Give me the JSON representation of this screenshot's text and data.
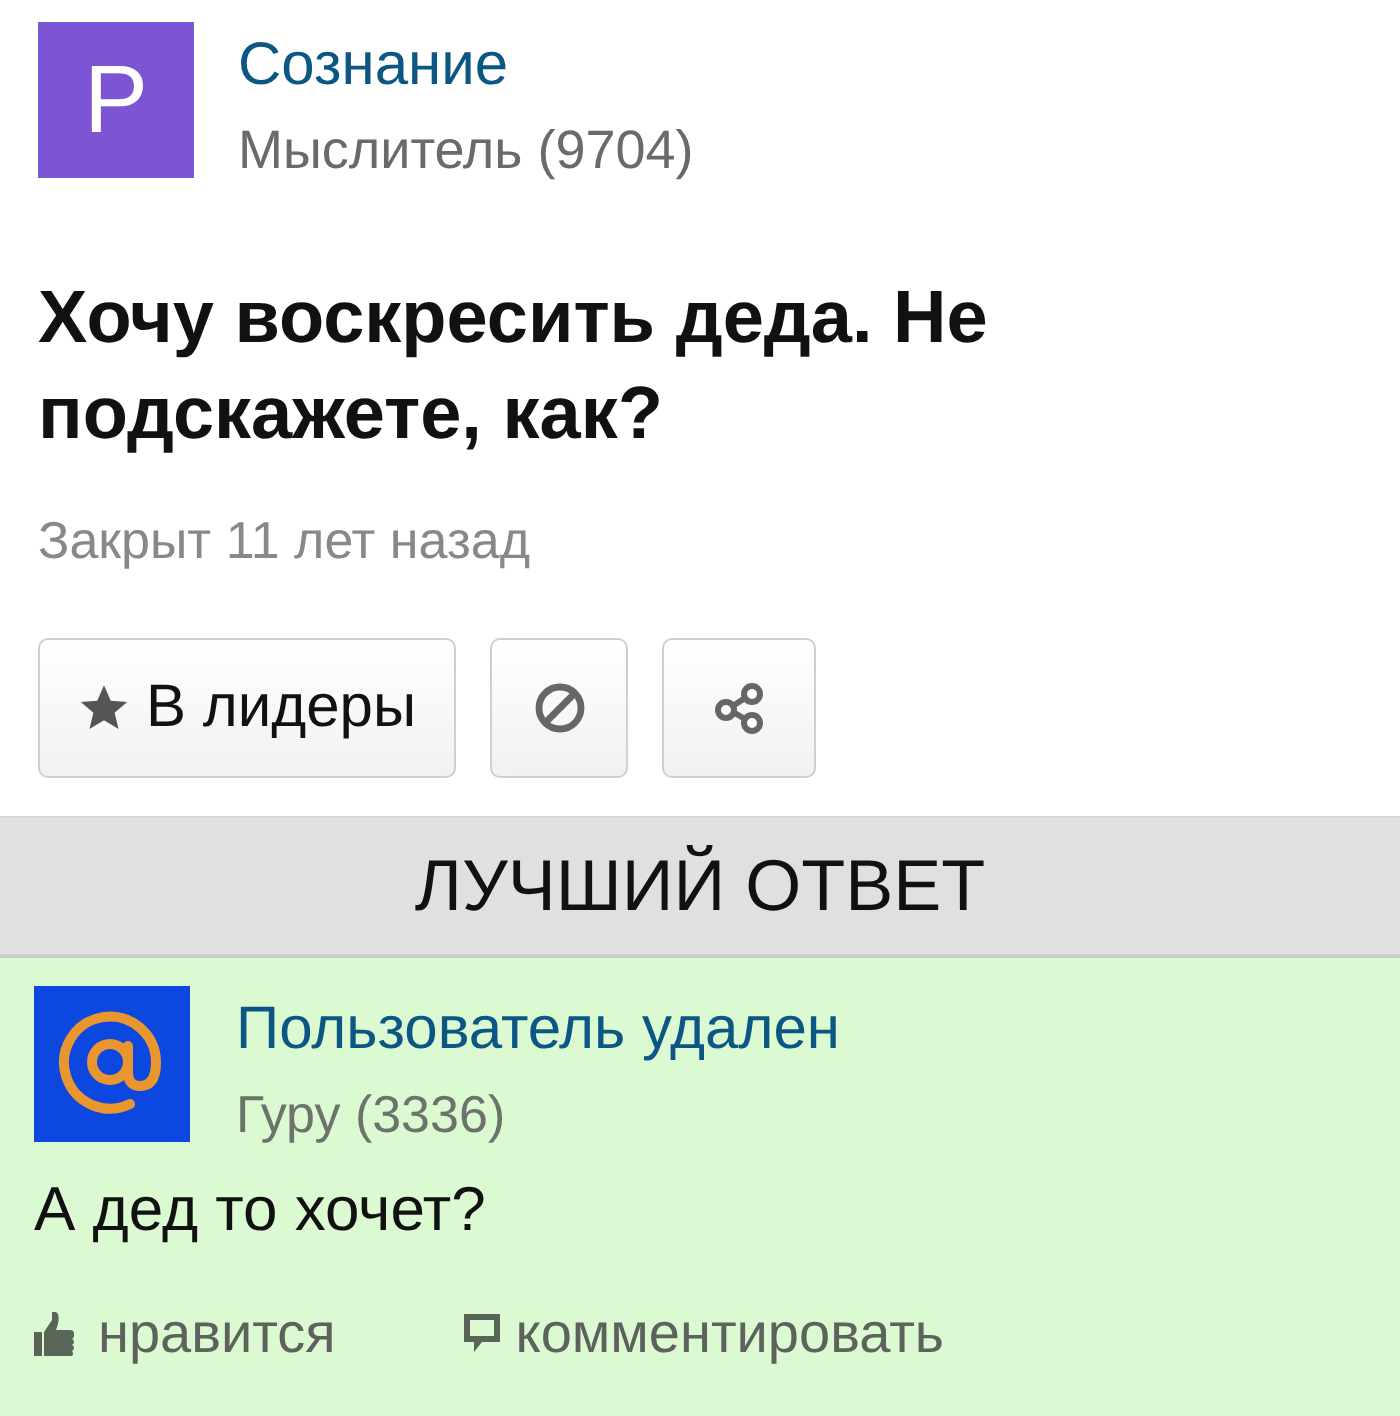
{
  "question": {
    "author": {
      "avatar_letter": "P",
      "name": "Сознание",
      "rank": "Мыслитель (9704)"
    },
    "title": "Хочу воскресить деда. Не подскажете, как?",
    "status": "Закрыт 11 лет назад",
    "actions": [
      {
        "kind": "leaders",
        "label": "В лидеры"
      },
      {
        "kind": "block"
      },
      {
        "kind": "share"
      }
    ]
  },
  "best_answer": {
    "heading": "ЛУЧШИЙ ОТВЕТ",
    "author": {
      "name": "Пользователь удален",
      "rank": "Гуру (3336)"
    },
    "text": "А дед то хочет?",
    "actions": [
      {
        "kind": "like",
        "label": "нравится"
      },
      {
        "kind": "comment",
        "label": "комментировать"
      }
    ]
  }
}
